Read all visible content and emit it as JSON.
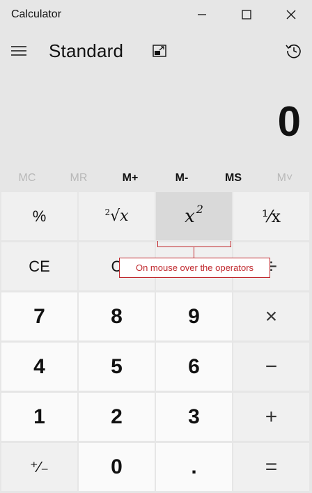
{
  "window": {
    "title": "Calculator",
    "minimize_icon": "minimize-icon",
    "maximize_icon": "maximize-icon",
    "close_icon": "close-icon"
  },
  "header": {
    "mode": "Standard",
    "menu_icon": "hamburger-icon",
    "keep_on_top_icon": "keep-on-top-icon",
    "history_icon": "history-icon"
  },
  "display": {
    "value": "0"
  },
  "memory": {
    "mc": "MC",
    "mr": "MR",
    "m_plus": "M+",
    "m_minus": "M-",
    "ms": "MS",
    "m_list": "M˅"
  },
  "keys": {
    "percent": "%",
    "cube_root_index": "2",
    "cube_root_x": "√x",
    "square_x": "x",
    "square_sup": "2",
    "reciprocal": "⅟x",
    "ce": "CE",
    "c": "C",
    "backspace": "⌫",
    "divide": "÷",
    "seven": "7",
    "eight": "8",
    "nine": "9",
    "multiply": "×",
    "four": "4",
    "five": "5",
    "six": "6",
    "minus": "−",
    "one": "1",
    "two": "2",
    "three": "3",
    "plus": "+",
    "negate": "⁺∕₋",
    "zero": "0",
    "decimal": ".",
    "equals": "="
  },
  "annotation": {
    "text": "On mouse over the operators"
  },
  "colors": {
    "annotation": "#c0282d",
    "background": "#e6e6e6",
    "number_key": "#fafafa",
    "function_key": "#f0f0f0"
  }
}
